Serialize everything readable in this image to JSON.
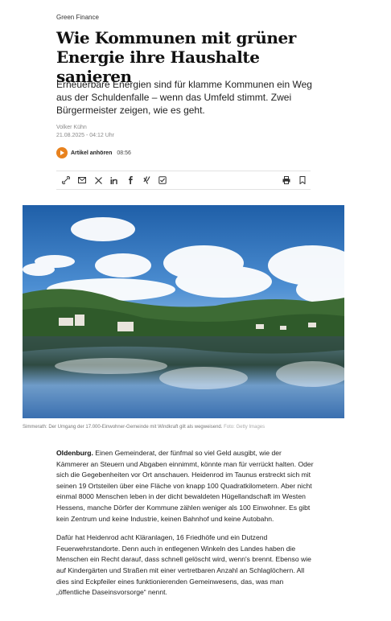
{
  "article": {
    "kicker": "Green Finance",
    "title": "Wie Kommunen mit grüner Energie ihre Haushalte sanieren",
    "lead": "Erneuerbare Energien sind für klamme Kommunen ein Weg aus der Schuldenfalle – wenn das Umfeld stimmt. Zwei Bürgermeister zeigen, wie es geht.",
    "author": "Volker Kühn",
    "date": "21.08.2025 - 04:12 Uhr"
  },
  "audio": {
    "label": "Artikel anhören",
    "duration": "08:56",
    "accent": "#e8821e"
  },
  "share_icons": [
    "link-icon",
    "mail-icon",
    "x-icon",
    "linkedin-icon",
    "facebook-icon",
    "xing-icon",
    "whatsapp-icon",
    "print-icon",
    "bookmark-icon"
  ],
  "caption": {
    "text": "Simmerath: Der Umgang der 17.000-Einwohner-Gemeinde mit Windkraft gilt als wegweisend.",
    "credit": "Foto: Getty Images"
  },
  "body": {
    "p1_dateline": "Oldenburg.",
    "p1": " Einen Gemeinderat, der fünfmal so viel Geld ausgibt, wie der Kämmerer an Steuern und Abgaben einnimmt, könnte man für verrückt halten. Oder sich die Gegebenheiten vor Ort anschauen. Heidenrod im Taunus erstreckt sich mit seinen 19 Ortsteilen über eine Fläche von knapp 100 Quadratkilometern. Aber nicht einmal 8000 Menschen leben in der dicht bewaldeten Hügellandschaft im Westen Hessens, manche Dörfer der Kommune zählen weniger als 100 Einwohner. Es gibt kein Zentrum und keine Industrie, keinen Bahnhof und keine Autobahn.",
    "p2": "Dafür hat Heidenrod acht Kläranlagen, 16 Friedhöfe und ein Dutzend Feuerwehrstandorte. Denn auch in entlegenen Winkeln des Landes haben die Menschen ein Recht darauf, dass schnell gelöscht wird, wenn's brennt. Ebenso wie auf Kindergärten und Straßen mit einer vertretbaren Anzahl an Schlaglöchern. All dies sind Eckpfeiler eines funktionierenden Gemeinwesens, das, was man „öffentliche Daseinsvorsorge“ nennt."
  }
}
